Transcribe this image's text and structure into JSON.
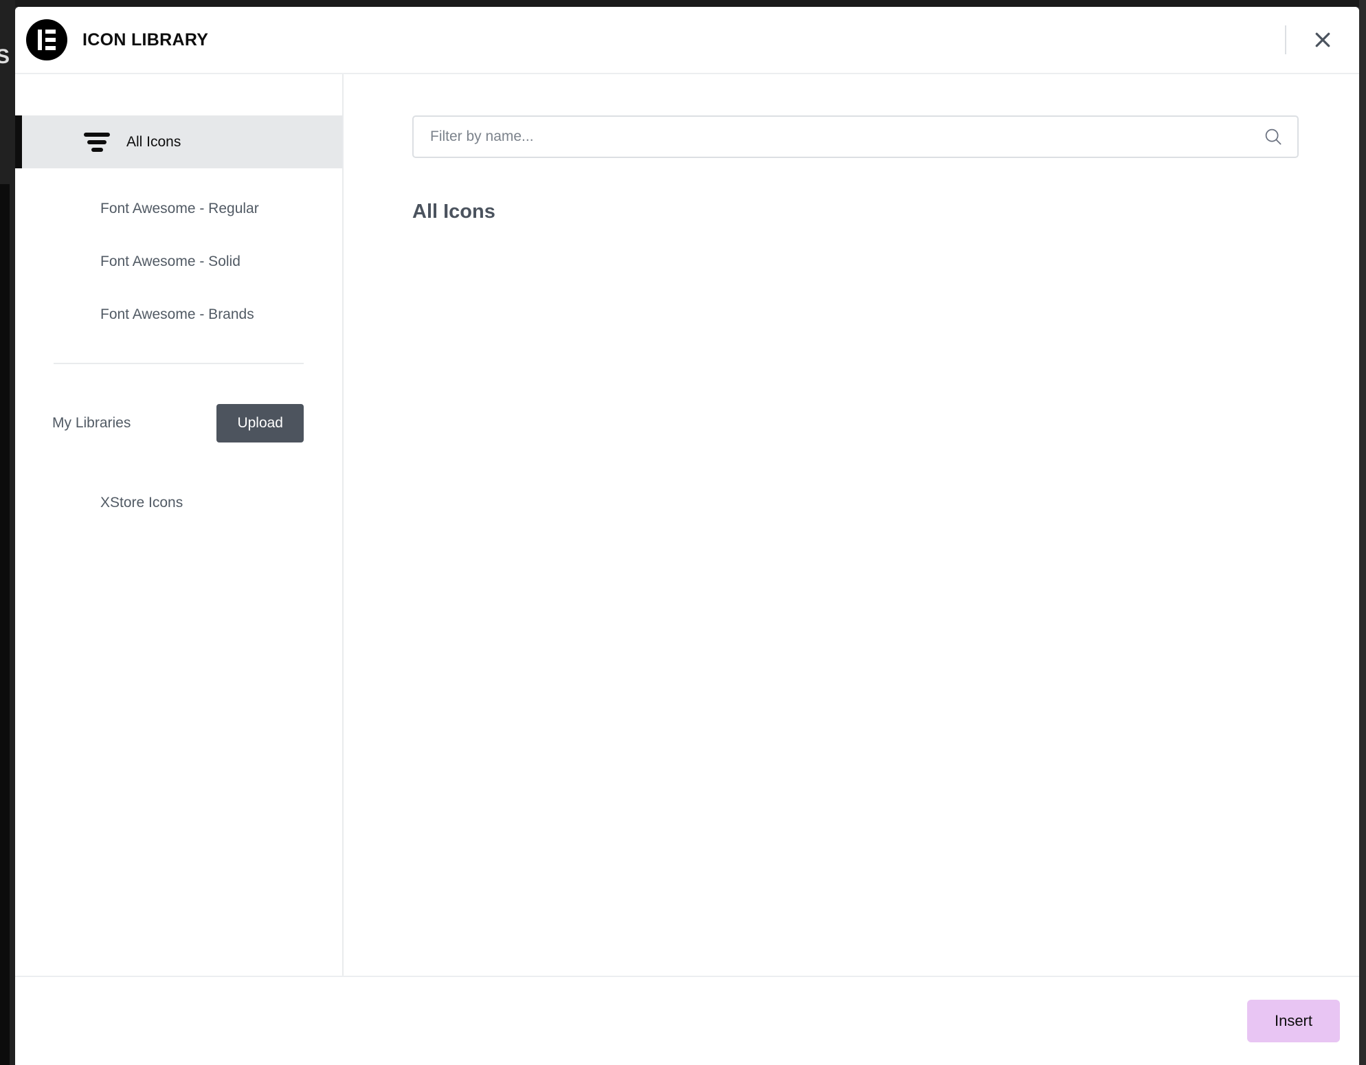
{
  "header": {
    "title": "ICON LIBRARY",
    "logo_icon": "elementor-logo-icon",
    "close_icon": "close-icon"
  },
  "backdrop": {
    "ghost_text": "S"
  },
  "sidebar": {
    "primary_items": [
      {
        "label": "All Icons",
        "icon": "filter-icon",
        "active": true
      },
      {
        "label": "Font Awesome - Regular",
        "active": false
      },
      {
        "label": "Font Awesome - Solid",
        "active": false
      },
      {
        "label": "Font Awesome - Brands",
        "active": false
      }
    ],
    "my_libraries": {
      "label": "My Libraries",
      "upload_label": "Upload"
    },
    "library_items": [
      {
        "label": "XStore Icons"
      }
    ]
  },
  "search": {
    "placeholder": "Filter by name...",
    "value": "",
    "icon": "search-icon"
  },
  "main": {
    "section_title": "All Icons",
    "icons": []
  },
  "footer": {
    "insert_label": "Insert"
  },
  "colors": {
    "accent_insert": "#e8c5f3",
    "upload_button": "#4d545e",
    "active_item_bg": "#e6e8ea",
    "active_item_border": "#0d0d0d",
    "text_muted": "#515a64",
    "heading": "#4b535e"
  }
}
